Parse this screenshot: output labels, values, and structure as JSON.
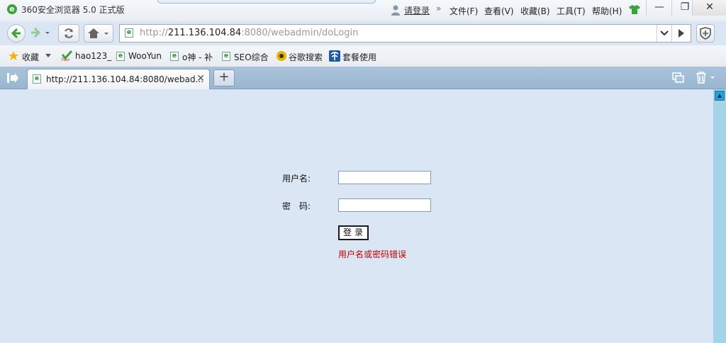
{
  "titlebar": {
    "app_title": "360安全浏览器 5.0 正式版",
    "login_link": "请登录",
    "menus": [
      "文件(F)",
      "查看(V)",
      "收藏(B)",
      "工具(T)",
      "帮助(H)"
    ],
    "minimize": "—",
    "maximize": "❐",
    "close": "✕"
  },
  "nav": {
    "url_prefix": "http://",
    "url_host": "211.136.104.84",
    "url_rest": ":8080/webadmin/doLogin"
  },
  "bookmarks": {
    "favorites_label": "收藏",
    "items": [
      "hao123_",
      "WooYun",
      "o神 - 补",
      "SEO综合",
      "谷歌搜索",
      "套餐使用"
    ]
  },
  "tab": {
    "title": "http://211.136.104.84:8080/webad...",
    "close": "✕",
    "new_tab": "+"
  },
  "form": {
    "username_label": "用户名:",
    "username_value": "",
    "password_label": "密　码:",
    "password_value": "",
    "submit_label": "登录",
    "error_message": "用户名或密码错误"
  },
  "colors": {
    "page_background": "#dbe6f4",
    "error_text": "#c00000",
    "tab_bar": "#a9c3da",
    "scrollbar": "#a4d4e8"
  }
}
